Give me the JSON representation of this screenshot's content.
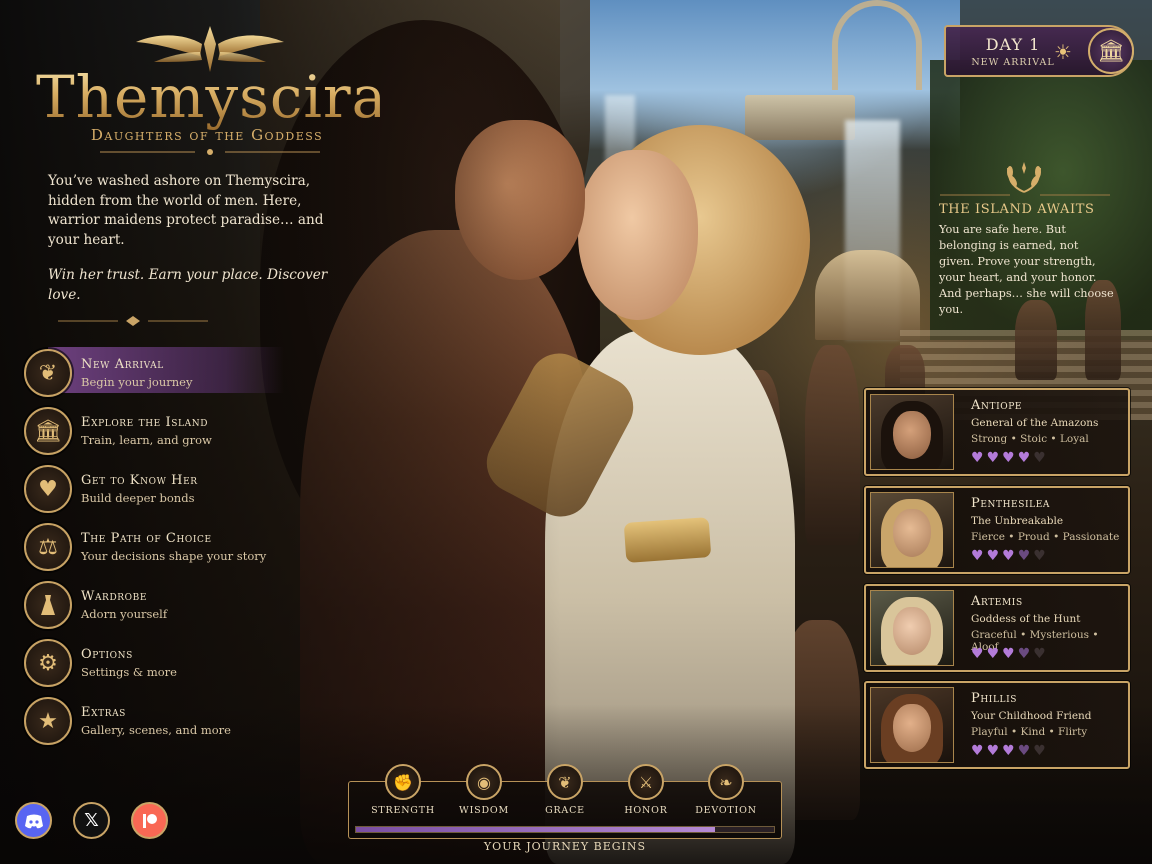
{
  "logo": {
    "title": "Themyscira",
    "subtitle": "Daughters of the Goddess"
  },
  "intro": {
    "paragraph1": "You’ve washed ashore on Themyscira, hidden from the world of men. Here, warrior maidens protect paradise… and your heart.",
    "paragraph2": "Win her trust. Earn your place. Discover love."
  },
  "menu": [
    {
      "title": "New Arrival",
      "subtitle": "Begin your journey",
      "icon": "laurel-icon",
      "active": true
    },
    {
      "title": "Explore the Island",
      "subtitle": "Train, learn, and grow",
      "icon": "temple-icon"
    },
    {
      "title": "Get to Know Her",
      "subtitle": "Build deeper bonds",
      "icon": "heart-icon"
    },
    {
      "title": "The Path of Choice",
      "subtitle": "Your decisions shape your story",
      "icon": "scales-icon"
    },
    {
      "title": "Wardrobe",
      "subtitle": "Adorn yourself",
      "icon": "dress-icon"
    },
    {
      "title": "Options",
      "subtitle": "Settings & more",
      "icon": "gear-icon"
    },
    {
      "title": "Extras",
      "subtitle": "Gallery, scenes, and more",
      "icon": "star-icon"
    }
  ],
  "socials": [
    {
      "name": "discord-icon"
    },
    {
      "name": "x-icon"
    },
    {
      "name": "patreon-icon"
    }
  ],
  "day": {
    "label": "DAY 1",
    "sub": "NEW ARRIVAL",
    "icons": [
      "sun-icon",
      "temple-icon"
    ]
  },
  "island": {
    "title": "THE ISLAND AWAITS",
    "text": "You are safe here. But belonging is earned, not given. Prove your strength, your heart, and your honor. And perhaps… she will choose you."
  },
  "characters": [
    {
      "name": "Antiope",
      "title": "General of the Amazons",
      "traits": "Strong • Stoic • Loyal",
      "affection": 4,
      "hearts_total": 5
    },
    {
      "name": "Penthesilea",
      "title": "The Unbreakable",
      "traits": "Fierce • Proud • Passionate",
      "affection": 3.5,
      "hearts_total": 5
    },
    {
      "name": "Artemis",
      "title": "Goddess of the Hunt",
      "traits": "Graceful • Mysterious • Aloof",
      "affection": 3.5,
      "hearts_total": 5
    },
    {
      "name": "Phillis",
      "title": "Your Childhood Friend",
      "traits": "Playful • Kind • Flirty",
      "affection": 3.5,
      "hearts_total": 5
    }
  ],
  "stats": [
    {
      "label": "STRENGTH",
      "icon": "fist-icon"
    },
    {
      "label": "WISDOM",
      "icon": "owl-icon"
    },
    {
      "label": "GRACE",
      "icon": "laurel-icon"
    },
    {
      "label": "HONOR",
      "icon": "crossed-swords-icon"
    },
    {
      "label": "DEVOTION",
      "icon": "wreath-icon"
    }
  ],
  "progress": {
    "fraction": 0.86,
    "label": "YOUR JOURNEY BEGINS"
  },
  "colors": {
    "gold": "#c9a466",
    "purple": "#7a4ea2",
    "heart": "#b37bd9"
  }
}
